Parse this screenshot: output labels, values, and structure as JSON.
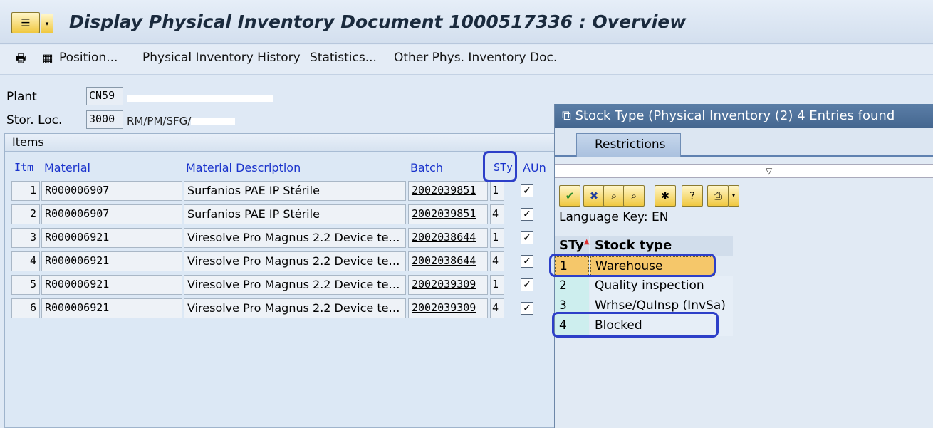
{
  "window": {
    "title": "Display Physical Inventory Document 1000517336 : Overview"
  },
  "toolbar": {
    "position_label": "Position...",
    "history_label": "Physical Inventory History",
    "statistics_label": "Statistics...",
    "other_doc_label": "Other Phys. Inventory Doc."
  },
  "header": {
    "plant_label": "Plant",
    "plant_value": "CN59",
    "stor_loc_label": "Stor. Loc.",
    "stor_loc_value": "3000",
    "stor_loc_desc": "RM/PM/SFG/"
  },
  "items": {
    "section_title": "Items",
    "columns": [
      "Itm",
      "Material",
      "Material Description",
      "Batch",
      "STy",
      "AUn"
    ],
    "rows": [
      {
        "itm": "1",
        "material": "R000006907",
        "desc": "Surfanios PAE IP Stérile",
        "batch": "2002039851",
        "sty": "1",
        "aun": "✓"
      },
      {
        "itm": "2",
        "material": "R000006907",
        "desc": "Surfanios PAE IP Stérile",
        "batch": "2002039851",
        "sty": "4",
        "aun": "✓"
      },
      {
        "itm": "3",
        "material": "R000006921",
        "desc": "Viresolve Pro Magnus 2.2 Device te…",
        "batch": "2002038644",
        "sty": "1",
        "aun": "✓"
      },
      {
        "itm": "4",
        "material": "R000006921",
        "desc": "Viresolve Pro Magnus 2.2 Device te…",
        "batch": "2002038644",
        "sty": "4",
        "aun": "✓"
      },
      {
        "itm": "5",
        "material": "R000006921",
        "desc": "Viresolve Pro Magnus 2.2 Device te…",
        "batch": "2002039309",
        "sty": "1",
        "aun": "✓"
      },
      {
        "itm": "6",
        "material": "R000006921",
        "desc": "Viresolve Pro Magnus 2.2 Device te…",
        "batch": "2002039309",
        "sty": "4",
        "aun": "✓"
      }
    ]
  },
  "popup": {
    "title": "Stock Type (Physical Inventory (2)   4 Entries found",
    "tab_label": "Restrictions",
    "language_key": "Language Key: EN",
    "col_sty": "STy",
    "col_stock_type": "Stock type",
    "entries": [
      {
        "sty": "1",
        "label": "Warehouse"
      },
      {
        "sty": "2",
        "label": "Quality inspection"
      },
      {
        "sty": "3",
        "label": "Wrhse/QuInsp (InvSa)"
      },
      {
        "sty": "4",
        "label": "Blocked"
      }
    ]
  },
  "icons": {
    "title": "sap-menu-icon",
    "toolbar_print": "print-icon",
    "toolbar_position": "position-icon"
  },
  "colors": {
    "highlight": "#2d3fc8",
    "selected_row": "#f5c76a",
    "column_header": "#1a33cc"
  }
}
